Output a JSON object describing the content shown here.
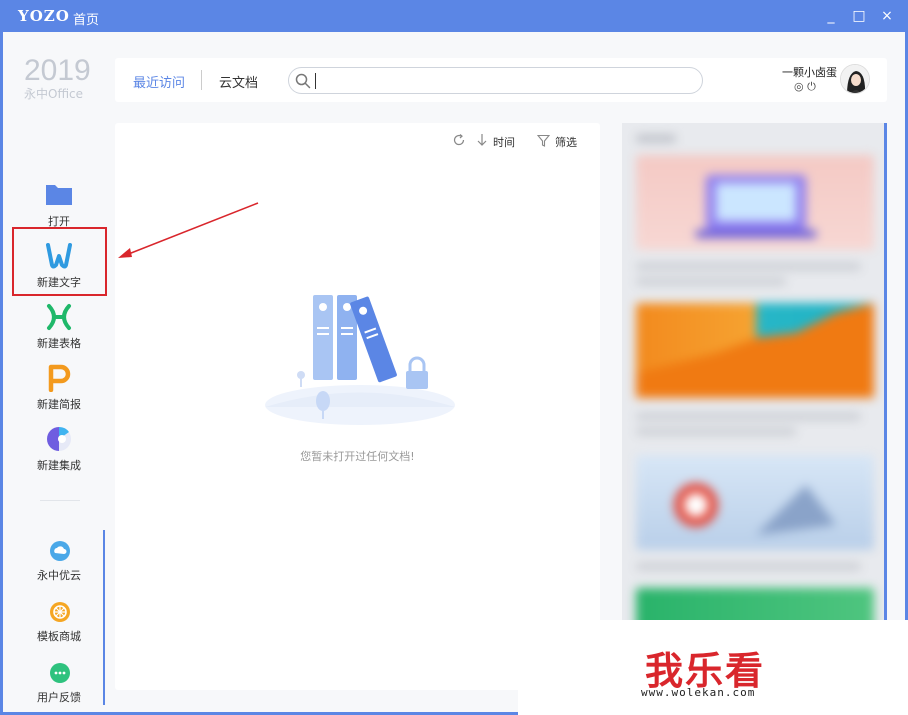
{
  "titlebar": {
    "brand": "YOZO",
    "title": "首页",
    "controls": [
      "_",
      "□",
      "×"
    ]
  },
  "sidebar": {
    "year": "2019",
    "product": "永中Office",
    "items": [
      {
        "label": "打开",
        "icon": "folder-icon"
      },
      {
        "label": "新建文字",
        "icon": "word-doc-icon"
      },
      {
        "label": "新建表格",
        "icon": "spreadsheet-icon"
      },
      {
        "label": "新建简报",
        "icon": "presentation-icon"
      },
      {
        "label": "新建集成",
        "icon": "integrated-icon"
      }
    ],
    "bottom_items": [
      {
        "label": "永中优云",
        "icon": "cloud-icon"
      },
      {
        "label": "模板商城",
        "icon": "template-store-icon"
      },
      {
        "label": "用户反馈",
        "icon": "feedback-icon"
      }
    ]
  },
  "topbar": {
    "tabs": [
      {
        "label": "最近访问",
        "active": true
      },
      {
        "label": "云文档",
        "active": false
      }
    ],
    "search_value": "",
    "user_name": "一颗小卤蛋",
    "user_icons": "◎ ⏻"
  },
  "content": {
    "sort_time": "时间",
    "filter": "筛选",
    "empty_message": "您暂未打开过任何文档!"
  },
  "watermark": {
    "text": "我乐看",
    "url": "www.wolekan.com"
  },
  "colors": {
    "accent": "#5b86e5",
    "highlight_red": "#d9262c"
  }
}
